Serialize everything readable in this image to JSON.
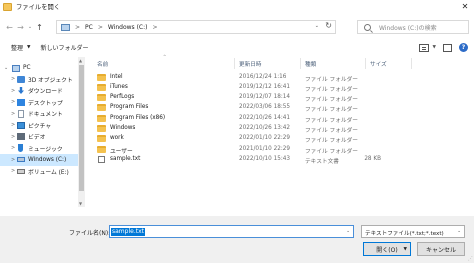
{
  "window": {
    "title": "ファイルを開く",
    "close_glyph": "✕"
  },
  "nav": {
    "back_glyph": "←",
    "forward_glyph": "→",
    "recent_glyph": "⌄",
    "up_glyph": "↑",
    "breadcrumb": [
      "PC",
      "Windows (C:)"
    ],
    "separator": ">",
    "dropdown_glyph": "⌄",
    "refresh_glyph": "↻",
    "search_placeholder": "Windows (C:)の検索"
  },
  "toolbar": {
    "organize_label": "整理",
    "organize_arrow": "▼",
    "new_folder_label": "新しいフォルダー",
    "view_menu_arrow": "▼",
    "help_glyph": "?"
  },
  "sidebar": {
    "items": [
      {
        "label": "PC",
        "icon": "pc-icon",
        "color": "#4a7fc0",
        "expanded": true
      },
      {
        "label": "3D オブジェクト",
        "icon": "3d-objects-icon",
        "color": "#3f86d6"
      },
      {
        "label": "ダウンロード",
        "icon": "download-icon",
        "color": "#2b78d0"
      },
      {
        "label": "デスクトップ",
        "icon": "desktop-icon",
        "color": "#2e84e0"
      },
      {
        "label": "ドキュメント",
        "icon": "documents-icon",
        "color": "#8a98a8"
      },
      {
        "label": "ピクチャ",
        "icon": "pictures-icon",
        "color": "#3a8fd8"
      },
      {
        "label": "ビデオ",
        "icon": "videos-icon",
        "color": "#5e6a78"
      },
      {
        "label": "ミュージック",
        "icon": "music-icon",
        "color": "#2a7fd4"
      },
      {
        "label": "Windows (C:)",
        "icon": "drive-icon",
        "color": "#3b7bc4",
        "selected": true
      },
      {
        "label": "ボリューム (E:)",
        "icon": "drive-icon",
        "color": "#6f6f6f"
      }
    ],
    "chevron_open": "⌄",
    "chevron_closed": ">",
    "scroll_up_glyph": "▲",
    "scroll_down_glyph": "▼"
  },
  "columns": {
    "name": "名前",
    "date": "更新日時",
    "type": "種類",
    "size": "サイズ",
    "sort_glyph": "^"
  },
  "files": [
    {
      "name": "Intel",
      "date": "2016/12/24 1:16",
      "type": "ファイル フォルダー",
      "size": "",
      "icon": "folder-icon"
    },
    {
      "name": "iTunes",
      "date": "2019/12/12 16:41",
      "type": "ファイル フォルダー",
      "size": "",
      "icon": "folder-icon"
    },
    {
      "name": "PerfLogs",
      "date": "2019/12/07 18:14",
      "type": "ファイル フォルダー",
      "size": "",
      "icon": "folder-icon"
    },
    {
      "name": "Program Files",
      "date": "2022/03/06 18:55",
      "type": "ファイル フォルダー",
      "size": "",
      "icon": "folder-icon"
    },
    {
      "name": "Program Files (x86)",
      "date": "2022/10/26 14:41",
      "type": "ファイル フォルダー",
      "size": "",
      "icon": "folder-icon"
    },
    {
      "name": "Windows",
      "date": "2022/10/26 13:42",
      "type": "ファイル フォルダー",
      "size": "",
      "icon": "folder-icon"
    },
    {
      "name": "work",
      "date": "2022/01/10 22:29",
      "type": "ファイル フォルダー",
      "size": "",
      "icon": "folder-icon"
    },
    {
      "name": "ユーザー",
      "date": "2021/01/10 22:29",
      "type": "ファイル フォルダー",
      "size": "",
      "icon": "folder-icon"
    },
    {
      "name": "sample.txt",
      "date": "2022/10/10 15:43",
      "type": "テキスト文書",
      "size": "28 KB",
      "icon": "text-document-icon"
    }
  ],
  "footer": {
    "filename_label": "ファイル名(N):",
    "filename_value": "sample.txt",
    "filename_dropdown_glyph": "⌄",
    "filetype_value": "テキストファイル(*.txt;*.text)",
    "filetype_dropdown_glyph": "⌄",
    "open_label": "開く(O)",
    "open_arrow": "▼",
    "cancel_label": "キャンセル",
    "grip_glyph": "⋰"
  },
  "colors": {
    "accent": "#0078d7",
    "selection": "#cce8ff",
    "folder": "#f4c24f",
    "column_header_text": "#4c607a"
  }
}
